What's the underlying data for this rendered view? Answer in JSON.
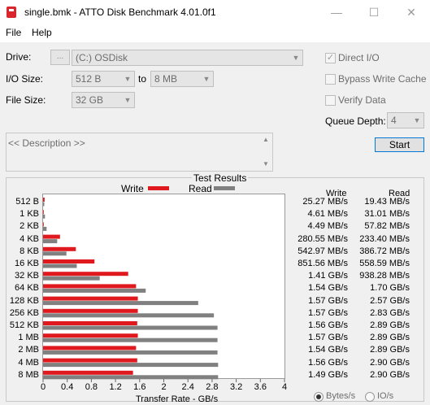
{
  "window": {
    "title": "single.bmk - ATTO Disk Benchmark 4.01.0f1",
    "minimize": "—",
    "maximize": "☐",
    "close": "✕"
  },
  "menu": {
    "file": "File",
    "help": "Help"
  },
  "settings": {
    "drive_label": "Drive:",
    "drive_browse": "...",
    "drive_value": "(C:) OSDisk",
    "io_label": "I/O Size:",
    "io_from": "512 B",
    "io_to_label": "to",
    "io_to": "8 MB",
    "file_label": "File Size:",
    "file_value": "32 GB",
    "direct_io_label": "Direct I/O",
    "direct_io_checked": true,
    "bypass_label": "Bypass Write Cache",
    "bypass_checked": false,
    "verify_label": "Verify Data",
    "verify_checked": false,
    "queue_label": "Queue Depth:",
    "queue_value": "4",
    "description_placeholder": "<< Description >>",
    "start_label": "Start"
  },
  "results": {
    "title": "Test Results",
    "write_legend": "Write",
    "read_legend": "Read",
    "write_header": "Write",
    "read_header": "Read",
    "xlabel": "Transfer Rate - GB/s",
    "ticks": [
      "0",
      "0.4",
      "0.8",
      "1.2",
      "1.6",
      "2",
      "2.4",
      "2.8",
      "3.2",
      "3.6",
      "4"
    ],
    "radio_bytes": "Bytes/s",
    "radio_io": "IO/s",
    "radio_selected": "Bytes/s",
    "colors": {
      "write": "#e0191f",
      "read": "#808080"
    }
  },
  "chart_data": {
    "type": "bar",
    "categories": [
      "512 B",
      "1 KB",
      "2 KB",
      "4 KB",
      "8 KB",
      "16 KB",
      "32 KB",
      "64 KB",
      "128 KB",
      "256 KB",
      "512 KB",
      "1 MB",
      "2 MB",
      "4 MB",
      "8 MB"
    ],
    "series": [
      {
        "name": "Write",
        "values": [
          0.02527,
          0.00461,
          0.00449,
          0.28055,
          0.54297,
          0.85156,
          1.41,
          1.54,
          1.57,
          1.57,
          1.56,
          1.57,
          1.54,
          1.56,
          1.49
        ],
        "labels": [
          "25.27 MB/s",
          "4.61 MB/s",
          "4.49 MB/s",
          "280.55 MB/s",
          "542.97 MB/s",
          "851.56 MB/s",
          "1.41 GB/s",
          "1.54 GB/s",
          "1.57 GB/s",
          "1.57 GB/s",
          "1.56 GB/s",
          "1.57 GB/s",
          "1.54 GB/s",
          "1.56 GB/s",
          "1.49 GB/s"
        ]
      },
      {
        "name": "Read",
        "values": [
          0.01943,
          0.03101,
          0.05782,
          0.2334,
          0.38672,
          0.55859,
          0.93828,
          1.7,
          2.57,
          2.83,
          2.89,
          2.89,
          2.89,
          2.9,
          2.9
        ],
        "labels": [
          "19.43 MB/s",
          "31.01 MB/s",
          "57.82 MB/s",
          "233.40 MB/s",
          "386.72 MB/s",
          "558.59 MB/s",
          "938.28 MB/s",
          "1.70 GB/s",
          "2.57 GB/s",
          "2.83 GB/s",
          "2.89 GB/s",
          "2.89 GB/s",
          "2.89 GB/s",
          "2.90 GB/s",
          "2.90 GB/s"
        ]
      }
    ],
    "xlabel": "Transfer Rate - GB/s",
    "xlim": [
      0,
      4
    ],
    "title": "Test Results",
    "legend": "top-center"
  }
}
